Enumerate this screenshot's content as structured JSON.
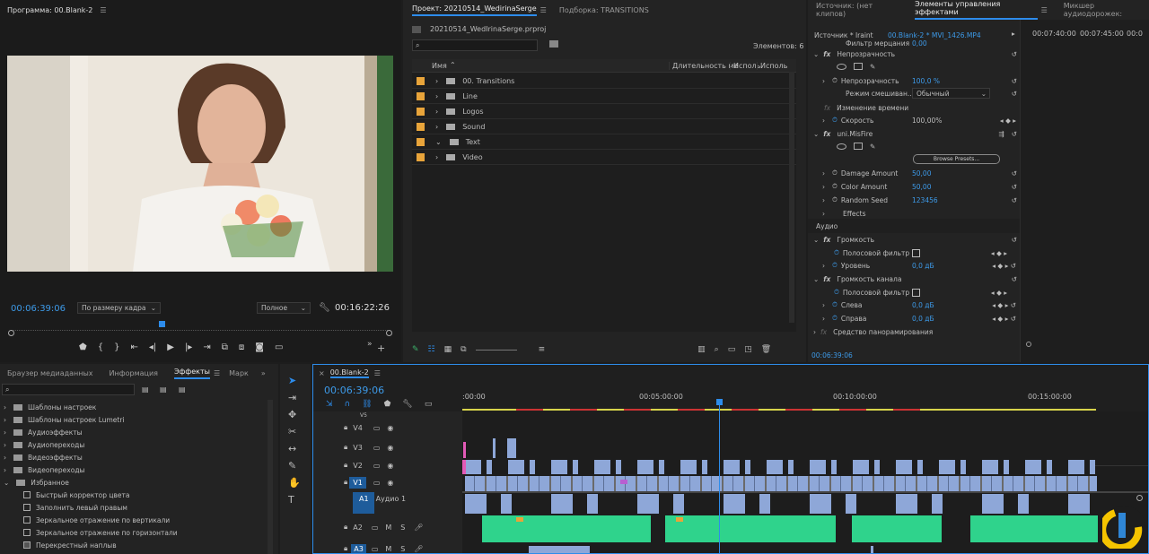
{
  "program": {
    "tab_title": "Программа: 00.Blank-2",
    "timecode": "00:06:39:06",
    "fit_select": "По размеру кадра",
    "quality_select": "Полное",
    "duration": "00:16:22:26"
  },
  "project": {
    "tab_title": "Проект: 20210514_WedirinaSerge",
    "tab2": "Подборка: TRANSITIONS",
    "file_name": "20210514_WedIrinaSerge.prproj",
    "items_count": "Элементов: 6",
    "col_name": "Имя",
    "col_duration": "Длительность ме",
    "col_use1": "Исполь",
    "col_use2": "Исполь",
    "folders": [
      "00. Transitions",
      "Line",
      "Logos",
      "Sound",
      "Text",
      "Video"
    ]
  },
  "effect_controls": {
    "tab_source": "Источник: (нет клипов)",
    "tab_effects": "Элементы управления эффектами",
    "tab_mixer": "Микшер аудиодорожек:",
    "source_label": "Источник * Iraint",
    "clip_label": "00.Blank-2 * MVI_1426.MP4",
    "ruler": [
      "00:07:40:00",
      "00:07:45:00",
      "00:0"
    ],
    "partial_row": "Фильтр мерцания",
    "partial_val": "0,00",
    "opacity_header": "Непрозрачность",
    "opacity_label": "Непрозрачность",
    "opacity_value": "100,0 %",
    "blend_label": "Режим смешиван...",
    "blend_value": "Обычный",
    "time_remap": "Изменение времени",
    "speed_label": "Скорость",
    "speed_value": "100,00%",
    "misfire": "uni.MisFire",
    "browse_presets": "Browse Presets...",
    "damage_label": "Damage Amount",
    "damage_value": "50,00",
    "color_label": "Color Amount",
    "color_value": "50,00",
    "seed_label": "Random Seed",
    "seed_value": "123456",
    "effects_label": "Effects",
    "audio_section": "Аудио",
    "volume": "Громкость",
    "bypass": "Полосовой фильтр",
    "level": "Уровень",
    "level_value": "0,0 дБ",
    "channel_volume": "Громкость канала",
    "bypass2": "Полосовой фильтр",
    "left": "Слева",
    "left_value": "0,0 дБ",
    "right": "Справа",
    "right_value": "0,0 дБ",
    "panner": "Средство панорамирования",
    "bottom_tc": "00:06:39:06"
  },
  "effects_panel": {
    "tabs": [
      "Браузер медиаданных",
      "Информация",
      "Эффекты",
      "Марк"
    ],
    "tree": [
      "Шаблоны настроек",
      "Шаблоны настроек Lumetri",
      "Аудиоэффекты",
      "Аудиопереходы",
      "Видеоэффекты",
      "Видеопереходы",
      "Избранное"
    ],
    "favorites": [
      "Быстрый корректор цвета",
      "Заполнить левый правым",
      "Зеркальное отражение по вертикали",
      "Зеркальное отражение по горизонтали",
      "Перекрестный наплыв"
    ]
  },
  "timeline": {
    "tab_title": "00.Blank-2",
    "timecode": "00:06:39:06",
    "ruler": [
      ":00:00",
      "00:05:00:00",
      "00:10:00:00",
      "00:15:00:00"
    ],
    "tracks": [
      {
        "id": "V5",
        "name": ""
      },
      {
        "id": "V4",
        "name": ""
      },
      {
        "id": "V3",
        "name": ""
      },
      {
        "id": "V2",
        "name": ""
      },
      {
        "id": "V1",
        "name": ""
      },
      {
        "id": "A1",
        "name": "Аудио 1"
      },
      {
        "id": "A2",
        "name": ""
      },
      {
        "id": "A3",
        "name": ""
      }
    ],
    "m_label": "M",
    "s_label": "S"
  },
  "colors": {
    "accent": "#2d8ceb",
    "audio_clip": "#2fd38c",
    "video_clip": "#8ea7d8",
    "folder": "#e8a43a",
    "logo_yellow": "#f5c400"
  }
}
